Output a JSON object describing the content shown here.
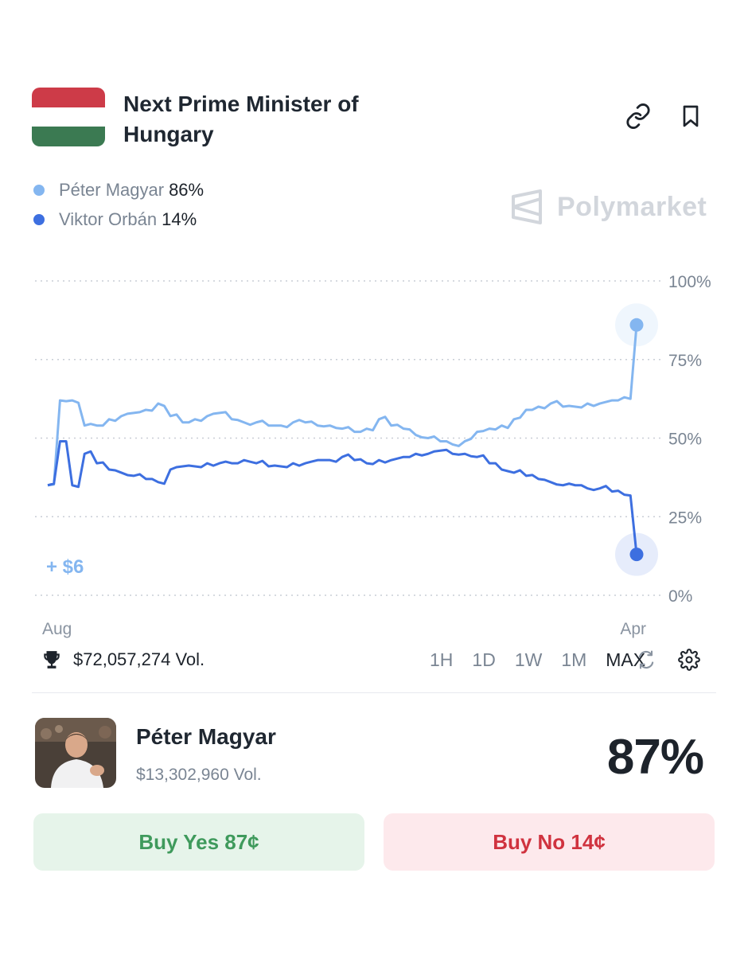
{
  "market": {
    "title": "Next Prime Minister of Hungary",
    "flag_colors": [
      "#cd3b48",
      "#ffffff",
      "#3b7a52"
    ]
  },
  "legend": [
    {
      "name": "Péter Magyar",
      "value": "86%",
      "color": "#84b6f0"
    },
    {
      "name": "Viktor Orbán",
      "value": "14%",
      "color": "#3d6fe0"
    }
  ],
  "brand": {
    "name": "Polymarket",
    "icon": "polymarket-logo-icon"
  },
  "chart_data": {
    "type": "line",
    "x_start_label": "Aug",
    "x_end_label": "Apr",
    "ylim": [
      0,
      100
    ],
    "y_ticks": [
      "100%",
      "75%",
      "50%",
      "25%",
      "0%"
    ],
    "grid": "horizontal dotted",
    "annotation": "+ $6",
    "series": [
      {
        "name": "Péter Magyar",
        "color": "#84b6f0",
        "values": [
          35,
          62,
          62,
          54,
          54,
          56,
          57,
          58,
          59,
          61,
          57,
          55,
          56,
          57,
          58,
          56,
          55,
          55,
          54,
          54,
          55,
          55,
          54,
          54,
          53,
          52,
          53,
          56,
          54,
          53,
          51,
          50,
          49,
          48,
          49,
          52,
          53,
          54,
          56,
          59,
          60,
          61,
          60,
          60,
          61,
          61,
          62,
          63,
          86
        ]
      },
      {
        "name": "Viktor Orbán",
        "color": "#3d6fe0",
        "values": [
          35,
          49,
          35,
          45,
          42,
          40,
          39,
          38,
          37,
          36,
          40,
          41,
          41,
          42,
          42,
          42,
          43,
          42,
          41,
          41,
          42,
          42,
          43,
          43,
          44,
          43,
          42,
          43,
          43,
          44,
          45,
          45,
          46,
          45,
          45,
          44,
          42,
          40,
          39,
          38,
          37,
          36,
          35,
          35,
          34,
          34,
          33,
          32,
          13
        ]
      }
    ]
  },
  "volume": {
    "total": "$72,057,274 Vol."
  },
  "ranges": {
    "r1": "1H",
    "r2": "1D",
    "r3": "1W",
    "r4": "1M",
    "r5": "MAX",
    "active": "MAX"
  },
  "candidate": {
    "name": "Péter Magyar",
    "volume": "$13,302,960 Vol.",
    "percent": "87%"
  },
  "buttons": {
    "yes": "Buy Yes 87¢",
    "no": "Buy No 14¢"
  }
}
